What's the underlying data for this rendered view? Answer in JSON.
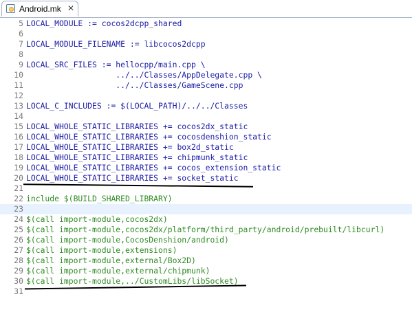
{
  "tab": {
    "title": "Android.mk",
    "close": "✕",
    "icon": "makefile-icon"
  },
  "lines": [
    {
      "n": "5",
      "text": "LOCAL_MODULE := cocos2dcpp_shared",
      "color": "blue"
    },
    {
      "n": "6",
      "text": "",
      "color": "blue"
    },
    {
      "n": "7",
      "text": "LOCAL_MODULE_FILENAME := libcocos2dcpp",
      "color": "blue"
    },
    {
      "n": "8",
      "text": "",
      "color": "blue"
    },
    {
      "n": "9",
      "text": "LOCAL_SRC_FILES := hellocpp/main.cpp \\",
      "color": "blue"
    },
    {
      "n": "10",
      "text": "                   ../../Classes/AppDelegate.cpp \\",
      "color": "blue"
    },
    {
      "n": "11",
      "text": "                   ../../Classes/GameScene.cpp",
      "color": "blue"
    },
    {
      "n": "12",
      "text": "",
      "color": "blue"
    },
    {
      "n": "13",
      "text": "LOCAL_C_INCLUDES := $(LOCAL_PATH)/../../Classes",
      "color": "blue"
    },
    {
      "n": "14",
      "text": "",
      "color": "blue"
    },
    {
      "n": "15",
      "text": "LOCAL_WHOLE_STATIC_LIBRARIES += cocos2dx_static",
      "color": "blue"
    },
    {
      "n": "16",
      "text": "LOCAL_WHOLE_STATIC_LIBRARIES += cocosdenshion_static",
      "color": "blue"
    },
    {
      "n": "17",
      "text": "LOCAL_WHOLE_STATIC_LIBRARIES += box2d_static",
      "color": "blue"
    },
    {
      "n": "18",
      "text": "LOCAL_WHOLE_STATIC_LIBRARIES += chipmunk_static",
      "color": "blue"
    },
    {
      "n": "19",
      "text": "LOCAL_WHOLE_STATIC_LIBRARIES += cocos_extension_static",
      "color": "blue"
    },
    {
      "n": "20",
      "text": "LOCAL_WHOLE_STATIC_LIBRARIES += socket_static",
      "color": "blue"
    },
    {
      "n": "21",
      "text": "",
      "color": "blue"
    },
    {
      "n": "22",
      "text": "include $(BUILD_SHARED_LIBRARY)",
      "color": "green"
    },
    {
      "n": "23",
      "text": "",
      "color": "blue",
      "current": true
    },
    {
      "n": "24",
      "text": "$(call import-module,cocos2dx)",
      "color": "green"
    },
    {
      "n": "25",
      "text": "$(call import-module,cocos2dx/platform/third_party/android/prebuilt/libcurl)",
      "color": "green"
    },
    {
      "n": "26",
      "text": "$(call import-module,CocosDenshion/android)",
      "color": "green"
    },
    {
      "n": "27",
      "text": "$(call import-module,extensions)",
      "color": "green"
    },
    {
      "n": "28",
      "text": "$(call import-module,external/Box2D)",
      "color": "green"
    },
    {
      "n": "29",
      "text": "$(call import-module,external/chipmunk)",
      "color": "green"
    },
    {
      "n": "30",
      "text": "$(call import-module,../CustomLibs/libSocket)",
      "color": "green"
    },
    {
      "n": "31",
      "text": "",
      "color": "blue"
    }
  ],
  "colors": {
    "keyword_blue": "#1a1aa6",
    "directive_green": "#2e8b22",
    "current_line": "#e8f2fe",
    "line_number": "#787878"
  }
}
